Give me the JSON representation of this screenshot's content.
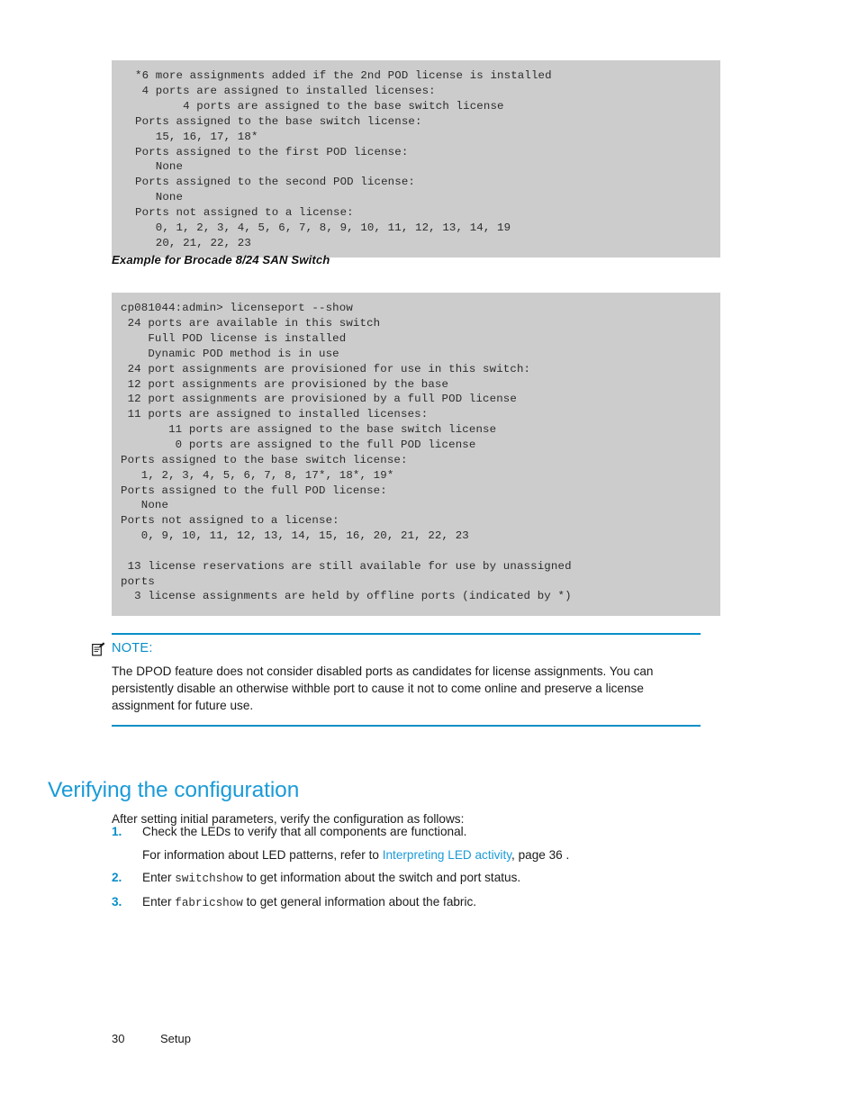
{
  "code_block_1": {
    "name": "licenseport-output-brocade-8-12c",
    "text": "*6 more assignments added if the 2nd POD license is installed\n 4 ports are assigned to installed licenses:\n       4 ports are assigned to the base switch license\nPorts assigned to the base switch license:\n   15, 16, 17, 18*\nPorts assigned to the first POD license:\n   None\nPorts assigned to the second POD license:\n   None\nPorts not assigned to a license:\n   0, 1, 2, 3, 4, 5, 6, 7, 8, 9, 10, 11, 12, 13, 14, 19\n   20, 21, 22, 23"
  },
  "example_caption": "Example for Brocade 8/24 SAN Switch",
  "code_block_2": {
    "name": "licenseport-output-brocade-8-24",
    "prompt": "cp081044:admin> licenseport --show",
    "text": "cp081044:admin> licenseport --show\n 24 ports are available in this switch\n    Full POD license is installed\n    Dynamic POD method is in use\n 24 port assignments are provisioned for use in this switch:\n 12 port assignments are provisioned by the base\n 12 port assignments are provisioned by a full POD license\n 11 ports are assigned to installed licenses:\n       11 ports are assigned to the base switch license\n        0 ports are assigned to the full POD license\nPorts assigned to the base switch license:\n   1, 2, 3, 4, 5, 6, 7, 8, 17*, 18*, 19*\nPorts assigned to the full POD license:\n   None\nPorts not assigned to a license:\n   0, 9, 10, 11, 12, 13, 14, 15, 16, 20, 21, 22, 23\n\n 13 license reservations are still available for use by unassigned\nports\n  3 license assignments are held by offline ports (indicated by *)"
  },
  "note": {
    "icon": "note-pencil-icon",
    "label": "NOTE:",
    "body": "The DPOD feature does not consider disabled ports as candidates for license assignments. You can persistently disable an otherwise withble port to cause it not to come online and preserve a license assignment for future use."
  },
  "section": {
    "heading": "Verifying the configuration",
    "intro": "After setting initial parameters, verify the configuration as follows:"
  },
  "procedure": [
    {
      "number": "1.",
      "text": "Check the LEDs to verify that all components are functional.",
      "sub_prefix": "For information about LED patterns, refer to ",
      "sub_link": "Interpreting LED activity",
      "sub_suffix": ", page 36 ."
    },
    {
      "number": "2.",
      "prefix": "Enter ",
      "code": "switchshow",
      "suffix": " to get information about the switch and port status."
    },
    {
      "number": "3.",
      "prefix": "Enter ",
      "code": "fabricshow",
      "suffix": " to get general information about the fabric."
    }
  ],
  "footer": {
    "page_number": "30",
    "chapter": "Setup"
  },
  "colors": {
    "accent_blue": "#1b9bd8",
    "rule_blue": "#0a8ec8",
    "code_bg": "#cccccc",
    "body_text": "#1a1a1a"
  }
}
